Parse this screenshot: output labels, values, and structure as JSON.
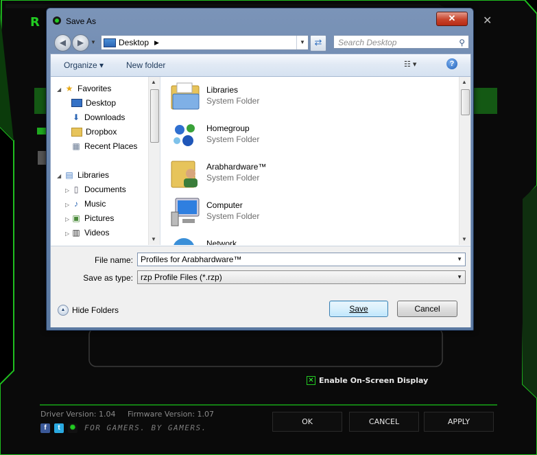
{
  "background_app": {
    "enable_osd_label": "Enable On-Screen Display",
    "enable_osd_checked": true,
    "driver_version": "Driver Version: 1.04",
    "firmware_version": "Firmware Version: 1.07",
    "tagline": "FOR GAMERS. BY GAMERS.",
    "buttons": {
      "ok": "OK",
      "cancel": "CANCEL",
      "apply": "APPLY"
    },
    "social": [
      "facebook-icon",
      "twitter-icon",
      "razer-icon"
    ],
    "accent_color": "#22cc22"
  },
  "dialog": {
    "title": "Save As",
    "close_label": "✕",
    "address": {
      "location": "Desktop"
    },
    "search_placeholder": "Search Desktop",
    "toolbar": {
      "organize": "Organize ▾",
      "new_folder": "New folder",
      "help": "?"
    },
    "nav": {
      "favorites": "Favorites",
      "favorites_items": [
        "Desktop",
        "Downloads",
        "Dropbox",
        "Recent Places"
      ],
      "libraries": "Libraries",
      "libraries_items": [
        "Documents",
        "Music",
        "Pictures",
        "Videos"
      ]
    },
    "files": [
      {
        "name": "Libraries",
        "type": "System Folder"
      },
      {
        "name": "Homegroup",
        "type": "System Folder"
      },
      {
        "name": "Arabhardware™",
        "type": "System Folder"
      },
      {
        "name": "Computer",
        "type": "System Folder"
      },
      {
        "name": "Network",
        "type": ""
      }
    ],
    "file_name_label": "File name:",
    "file_name_value": "Profiles for Arabhardware™",
    "save_as_type_label": "Save as type:",
    "save_as_type_value": "rzp Profile Files (*.rzp)",
    "hide_folders": "Hide Folders",
    "save_button": "Save",
    "cancel_button": "Cancel"
  }
}
